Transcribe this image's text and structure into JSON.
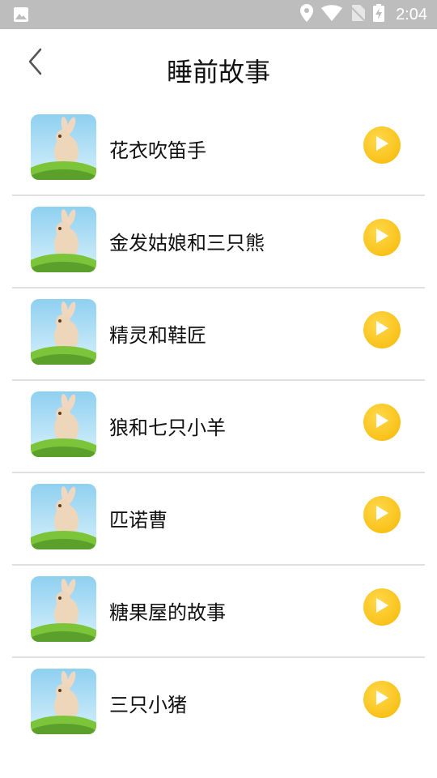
{
  "status_bar": {
    "time": "2:04",
    "icons": [
      "image-icon",
      "location-icon",
      "wifi-icon",
      "no-sim-icon",
      "battery-charging-icon"
    ]
  },
  "header": {
    "title": "睡前故事",
    "back_icon": "chevron-left-icon"
  },
  "colors": {
    "status_bar": "#bdbdbd",
    "play_button": "#f9c21a",
    "divider": "#e0e0e0"
  },
  "stories": [
    {
      "title": "花衣吹笛手",
      "thumb_icon": "rabbit-thumbnail",
      "action_icon": "play-icon"
    },
    {
      "title": "金发姑娘和三只熊",
      "thumb_icon": "rabbit-thumbnail",
      "action_icon": "play-icon"
    },
    {
      "title": "精灵和鞋匠",
      "thumb_icon": "rabbit-thumbnail",
      "action_icon": "play-icon"
    },
    {
      "title": "狼和七只小羊",
      "thumb_icon": "rabbit-thumbnail",
      "action_icon": "play-icon"
    },
    {
      "title": "匹诺曹",
      "thumb_icon": "rabbit-thumbnail",
      "action_icon": "play-icon"
    },
    {
      "title": "糖果屋的故事",
      "thumb_icon": "rabbit-thumbnail",
      "action_icon": "play-icon"
    },
    {
      "title": "三只小猪",
      "thumb_icon": "rabbit-thumbnail",
      "action_icon": "play-icon"
    }
  ]
}
